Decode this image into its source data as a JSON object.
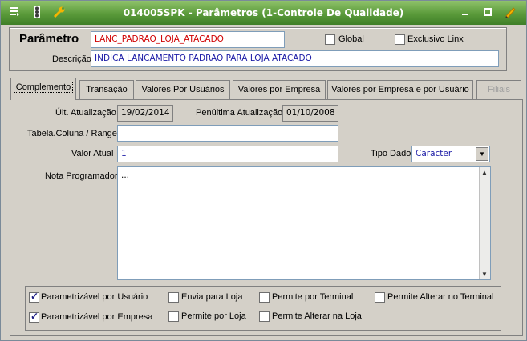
{
  "window": {
    "title": "014005SPK - Parâmetros (1-Controle De Qualidade)"
  },
  "header": {
    "parametro_label": "Parâmetro",
    "parametro_value": "LANC_PADRAO_LOJA_ATACADO",
    "global_label": "Global",
    "global_checked": false,
    "exclusivo_label": "Exclusivo Linx",
    "exclusivo_checked": false,
    "descricao_label": "Descrição",
    "descricao_value": "INDICA LANCAMENTO PADRAO PARA LOJA ATACADO"
  },
  "tabs": [
    {
      "label": "Complemento",
      "active": true
    },
    {
      "label": "Transação",
      "active": false
    },
    {
      "label": "Valores Por Usuários",
      "active": false
    },
    {
      "label": "Valores por Empresa",
      "active": false
    },
    {
      "label": "Valores por Empresa e por Usuário",
      "active": false
    },
    {
      "label": "Filiais",
      "active": false,
      "disabled": true
    }
  ],
  "form": {
    "ult_atualizacao_label": "Últ. Atualização",
    "ult_atualizacao_value": "19/02/2014",
    "penultima_label": "Penúltima Atualização",
    "penultima_value": "01/10/2008",
    "tabela_label": "Tabela.Coluna / Range",
    "tabela_value": "",
    "valor_atual_label": "Valor Atual",
    "valor_atual_value": "1",
    "tipo_dado_label": "Tipo Dado",
    "tipo_dado_value": "Caracter",
    "nota_label": "Nota Programador",
    "nota_value": "..."
  },
  "options": {
    "param_usuario": {
      "label": "Parametrizável por Usuário",
      "checked": true
    },
    "envia_loja": {
      "label": "Envia para Loja",
      "checked": false
    },
    "permite_terminal": {
      "label": "Permite por Terminal",
      "checked": false
    },
    "permite_alterar_terminal": {
      "label": "Permite Alterar no Terminal",
      "checked": false
    },
    "param_empresa": {
      "label": "Parametrizável por Empresa",
      "checked": true
    },
    "permite_loja": {
      "label": "Permite por Loja",
      "checked": false
    },
    "permite_alterar_loja": {
      "label": "Permite Alterar na Loja",
      "checked": false
    }
  },
  "icons": [
    "menu-icon",
    "traffic-light-icon",
    "wrench-icon",
    "minimize-icon",
    "maximize-icon",
    "close-icon",
    "pencil-icon"
  ]
}
